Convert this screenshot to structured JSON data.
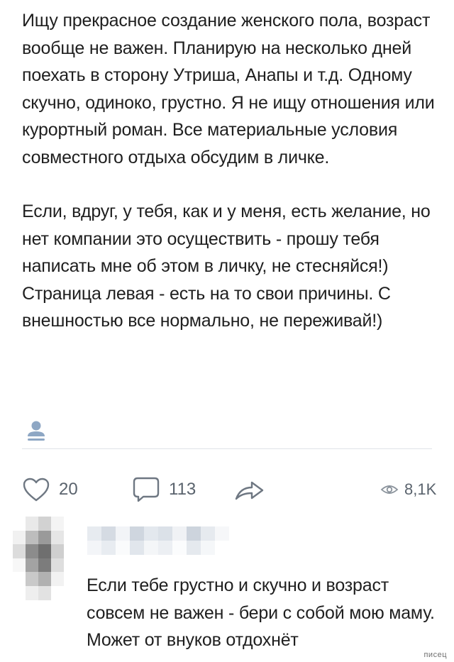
{
  "post": {
    "paragraph_1": "Ищу прекрасное создание женского пола, возраст вообще не важен. Планирую на несколько дней поехать в сторону Утриша, Анапы и т.д. Одному скучно, одиноко, грустно. Я не ищу отношения или курортный роман. Все материальные условия совместного отдыха обсудим в личке.",
    "paragraph_2": "Если, вдруг, у тебя, как и у меня, есть желание, но нет компании это осуществить - прошу тебя написать мне об этом в личку, не стесняйся!)",
    "paragraph_3": "Страница левая - есть на то свои причины. С внешностью все нормально, не переживай!)",
    "author_icon": "user-icon"
  },
  "actions": {
    "likes": "20",
    "comments": "113",
    "views": "8,1K",
    "like_icon": "heart-icon",
    "comment_icon": "speech-bubble-icon",
    "share_icon": "share-arrow-icon",
    "views_icon": "eye-icon"
  },
  "comment": {
    "text": "Если тебе грустно и скучно и возраст совсем не важен - бери с собой мою маму. Может от внуков отдохнёт"
  },
  "watermark": "писец",
  "colors": {
    "text": "#1f1f1f",
    "icon_gray": "#6e7782",
    "author_icon_blue": "#8ea7c4",
    "divider": "#dfe3e8"
  }
}
